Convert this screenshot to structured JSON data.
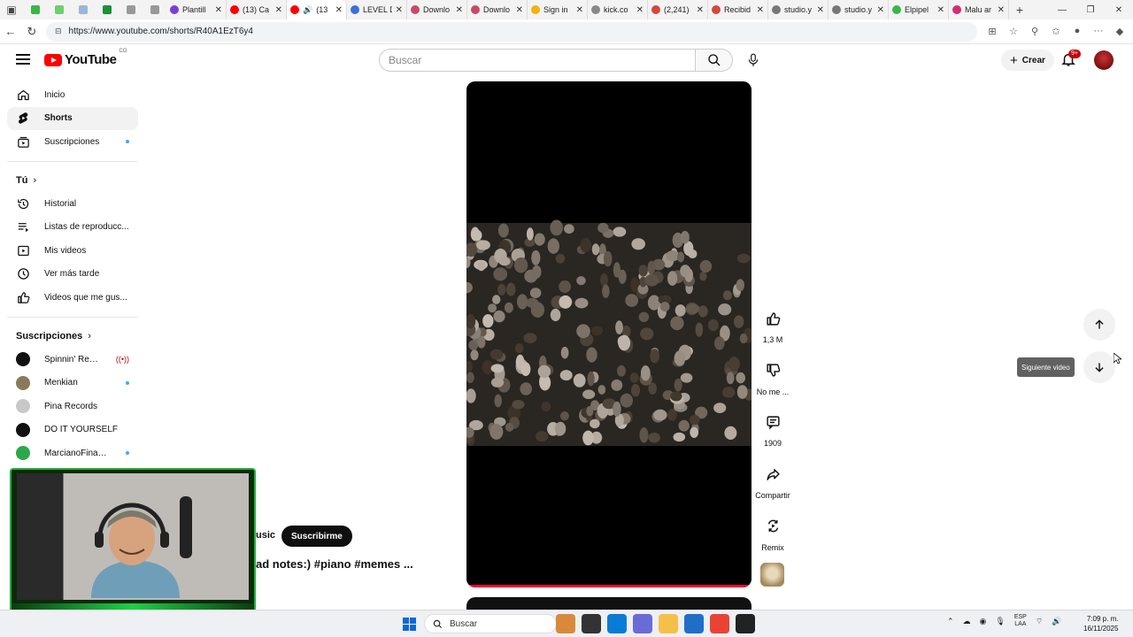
{
  "browser": {
    "url": "https://www.youtube.com/shorts/R40A1EzT6y4",
    "tabs": [
      {
        "title": "Plantill",
        "color": "#7a3fd1"
      },
      {
        "title": "(13) Ca",
        "color": "#ff0000"
      },
      {
        "title": "(13",
        "color": "#ff0000"
      },
      {
        "title": "LEVEL D",
        "color": "#3c6fd8"
      },
      {
        "title": "Downlo",
        "color": "#c84a6a"
      },
      {
        "title": "Downlo",
        "color": "#c84a6a"
      },
      {
        "title": "Sign in",
        "color": "#f2b40a"
      },
      {
        "title": "kick.co",
        "color": "#888888"
      },
      {
        "title": "(2,241)",
        "color": "#d4483b"
      },
      {
        "title": "Recibid",
        "color": "#d4483b"
      },
      {
        "title": "studio.y",
        "color": "#777777"
      },
      {
        "title": "studio.y",
        "color": "#777777"
      },
      {
        "title": "Elpipel",
        "color": "#3bb54a"
      },
      {
        "title": "Malu ar",
        "color": "#d62976"
      }
    ]
  },
  "masthead": {
    "logo_text": "YouTube",
    "country": "CO",
    "search_placeholder": "Buscar",
    "create_label": "Crear",
    "notif_badge": "9+"
  },
  "sidebar": {
    "main": [
      {
        "label": "Inicio",
        "icon": "home-icon"
      },
      {
        "label": "Shorts",
        "icon": "shorts-icon",
        "active": true
      },
      {
        "label": "Suscripciones",
        "icon": "subscriptions-icon",
        "dot": true
      }
    ],
    "you_header": "Tú",
    "you": [
      {
        "label": "Historial",
        "icon": "history-icon"
      },
      {
        "label": "Listas de reproducc...",
        "icon": "playlist-icon"
      },
      {
        "label": "Mis videos",
        "icon": "my-videos-icon"
      },
      {
        "label": "Ver más tarde",
        "icon": "watch-later-icon"
      },
      {
        "label": "Videos que me gus...",
        "icon": "liked-icon"
      }
    ],
    "subs_header": "Suscripciones",
    "subs": [
      {
        "label": "Spinnin' Records",
        "avatar_color": "#111111",
        "live": true
      },
      {
        "label": "Menkian",
        "avatar_color": "#8a7a5a",
        "dot": true
      },
      {
        "label": "Pina Records",
        "avatar_color": "#c8c8c8"
      },
      {
        "label": "DO IT YOURSELF",
        "avatar_color": "#111111"
      },
      {
        "label": "MarcianoFinanzas",
        "avatar_color": "#2aa84a",
        "dot": true
      }
    ]
  },
  "short": {
    "channel_fragment": "usic",
    "subscribe_label": "Suscribirme",
    "title_fragment": "ad notes:) #piano #memes ...",
    "progress": 1.0
  },
  "actions": [
    {
      "icon": "like-icon",
      "label": "1,3 M"
    },
    {
      "icon": "dislike-icon",
      "label": "No me ..."
    },
    {
      "icon": "comment-icon",
      "label": "1909"
    },
    {
      "icon": "share-icon",
      "label": "Compartir"
    },
    {
      "icon": "remix-icon",
      "label": "Remix"
    }
  ],
  "nav": {
    "tooltip": "Siguiente video"
  },
  "taskbar": {
    "search_label": "Buscar",
    "lang_top": "ESP",
    "lang_bottom": "LAA",
    "time": "7:09 p. m.",
    "date": "16/11/2025",
    "apps": [
      "#d88a3a",
      "#333333",
      "#0a7bd6",
      "#6b6bd8",
      "#f5c04a",
      "#1f6fc8",
      "#ea4335",
      "#222222"
    ]
  }
}
